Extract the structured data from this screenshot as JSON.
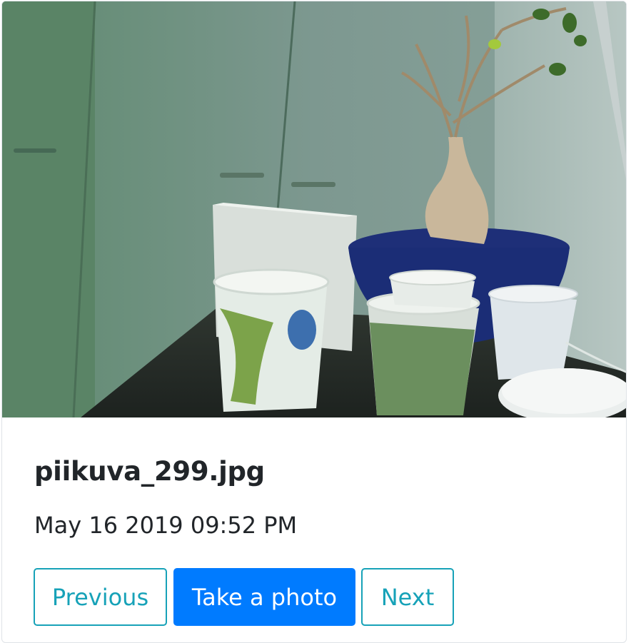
{
  "card": {
    "image_alt": "piikuva_299.jpg",
    "title": "piikuva_299.jpg",
    "timestamp": "May 16 2019 09:52 PM"
  },
  "buttons": {
    "previous": "Previous",
    "take_photo": "Take a photo",
    "next": "Next"
  },
  "colors": {
    "outline_info": "#17a2b8",
    "primary": "#007bff",
    "text": "#212529"
  }
}
